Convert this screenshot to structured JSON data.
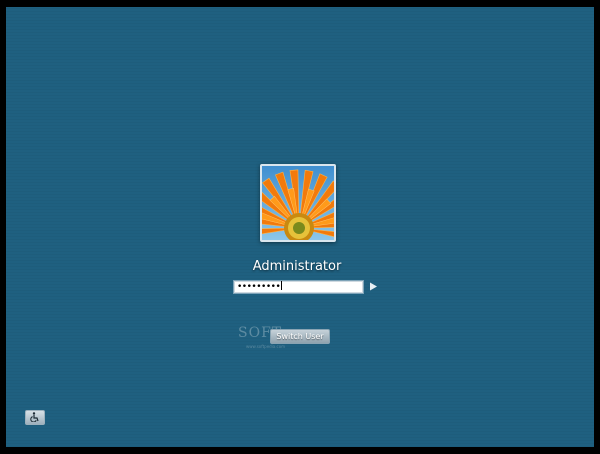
{
  "login": {
    "user_name": "Administrator",
    "password_masked": "•••••••••",
    "submit_icon": "arrow-right-icon",
    "switch_user_label": "Switch User"
  },
  "watermark": {
    "brand": "SOFT",
    "url": "www.softpedia.com"
  },
  "footer": {
    "ease_of_access_icon": "wheelchair-accessibility-icon"
  },
  "colors": {
    "background": "#1f6080",
    "outer_border": "#000000",
    "text": "#ffffff"
  }
}
